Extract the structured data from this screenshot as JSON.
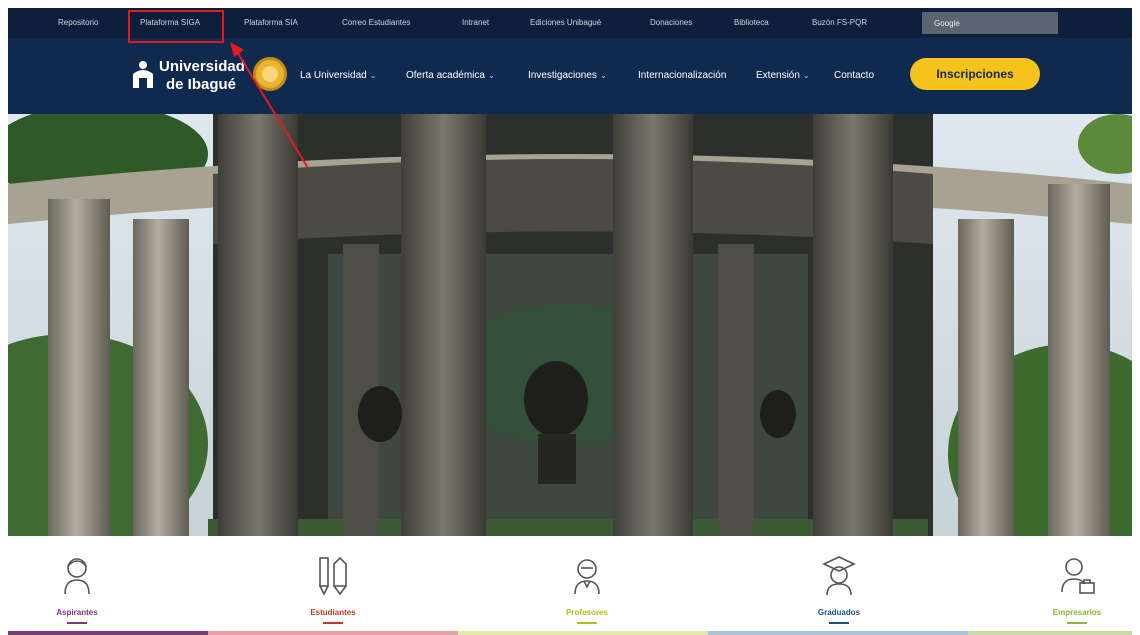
{
  "topbar": {
    "links": [
      {
        "label": "Repositorio"
      },
      {
        "label": "Plataforma SIGA"
      },
      {
        "label": "Plataforma SIA"
      },
      {
        "label": "Correo Estudiantes"
      },
      {
        "label": "Intranet"
      },
      {
        "label": "Ediciones Unibagué"
      },
      {
        "label": "Donaciones"
      },
      {
        "label": "Biblioteca"
      },
      {
        "label": "Buzón FS-PQR"
      }
    ],
    "search": {
      "placeholder": "Google"
    }
  },
  "navbar": {
    "logo": {
      "line1": "Universidad",
      "line2": "de Ibagué"
    },
    "items": [
      {
        "label": "La Universidad",
        "caret": "⌄"
      },
      {
        "label": "Oferta académica",
        "caret": "⌄"
      },
      {
        "label": "Investigaciones",
        "caret": "⌄"
      },
      {
        "label": "Internacionalización",
        "caret": ""
      },
      {
        "label": "Extensión",
        "caret": "⌄"
      },
      {
        "label": "Contacto",
        "caret": ""
      }
    ],
    "cta_label": "Inscripciones"
  },
  "hero": {
    "image_icon": "photo-colonnade-icon"
  },
  "annotation": {
    "highlighted_item": "Plataforma SIGA",
    "color": "#e21c1c"
  },
  "audience": {
    "items": [
      {
        "label": "Aspirantes",
        "color": "#7a3b78",
        "icon": "person-icon"
      },
      {
        "label": "Estudiantes",
        "color": "#c0392b",
        "icon": "pencils-icon"
      },
      {
        "label": "Profesores",
        "color": "#b5bc1c",
        "icon": "teacher-icon"
      },
      {
        "label": "Graduados",
        "color": "#1b4f8a",
        "icon": "graduate-icon"
      },
      {
        "label": "Empresarios",
        "color": "#8db33a",
        "icon": "business-person-icon"
      }
    ]
  },
  "colors": {
    "topbar": "#0d1f3a",
    "navbar": "#0f2a4e",
    "cta": "#f5c31c",
    "accent_red": "#e21c1c"
  }
}
